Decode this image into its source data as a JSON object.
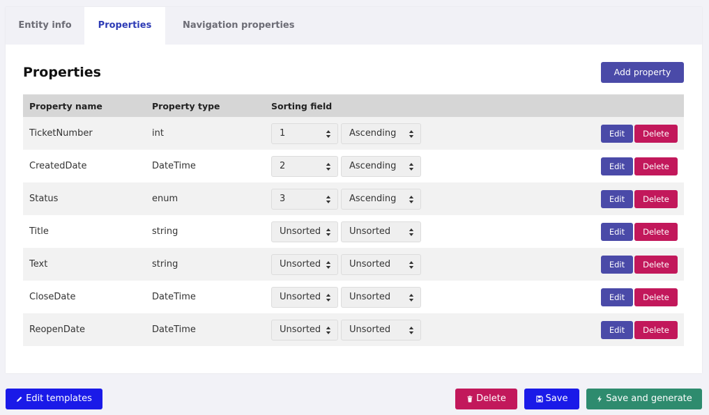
{
  "tabs": [
    {
      "label": "Entity info"
    },
    {
      "label": "Properties"
    },
    {
      "label": "Navigation properties"
    }
  ],
  "heading": "Properties",
  "add_button": "Add property",
  "columns": {
    "name": "Property name",
    "type": "Property type",
    "sorting": "Sorting field"
  },
  "rows": [
    {
      "name": "TicketNumber",
      "type": "int",
      "order": "1",
      "direction": "Ascending"
    },
    {
      "name": "CreatedDate",
      "type": "DateTime",
      "order": "2",
      "direction": "Ascending"
    },
    {
      "name": "Status",
      "type": "enum",
      "order": "3",
      "direction": "Ascending"
    },
    {
      "name": "Title",
      "type": "string",
      "order": "Unsorted",
      "direction": "Unsorted"
    },
    {
      "name": "Text",
      "type": "string",
      "order": "Unsorted",
      "direction": "Unsorted"
    },
    {
      "name": "CloseDate",
      "type": "DateTime",
      "order": "Unsorted",
      "direction": "Unsorted"
    },
    {
      "name": "ReopenDate",
      "type": "DateTime",
      "order": "Unsorted",
      "direction": "Unsorted"
    }
  ],
  "row_actions": {
    "edit": "Edit",
    "delete": "Delete"
  },
  "footer": {
    "edit_templates": "Edit templates",
    "delete": "Delete",
    "save": "Save",
    "save_generate": "Save and generate"
  },
  "colors": {
    "primary": "#4a4aa8",
    "danger": "#c2185b",
    "blue": "#1a1ae8",
    "success": "#2e8b6e",
    "active_tab_text": "#2d3bb5"
  },
  "icons": {
    "edit_templates": "pencil-icon",
    "delete": "trash-icon",
    "save": "floppy-icon",
    "save_generate": "bolt-icon",
    "select": "sort-arrows-icon"
  }
}
